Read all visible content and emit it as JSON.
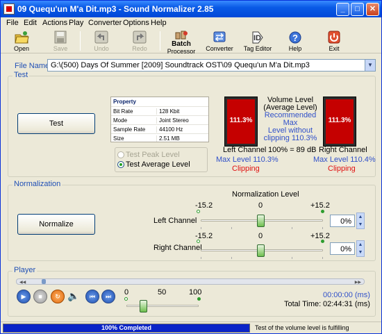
{
  "window": {
    "title": "09 Quequ'un M'a Dit.mp3 - Sound Normalizer 2.85"
  },
  "menu": [
    "File",
    "Edit",
    "Actions",
    "Play",
    "Converter",
    "Options",
    "Help"
  ],
  "toolbar": {
    "open": "Open",
    "save": "Save",
    "undo": "Undo",
    "redo": "Redo",
    "batch1": "Batch",
    "batch2": "Processor",
    "converter": "Converter",
    "tag": "Tag Editor",
    "help": "Help",
    "exit": "Exit"
  },
  "file": {
    "label": "File Name:",
    "value": "G:\\(500) Days Of Summer [2009] Soundtrack OST\\09 Quequ'un M'a Dit.mp3"
  },
  "test": {
    "group": "Test",
    "button": "Test",
    "props": {
      "header": "Property",
      "rows": [
        [
          "Bit Rate",
          "128 Kbit"
        ],
        [
          "Mode",
          "Joint Stereo"
        ],
        [
          "Sample Rate",
          "44100 Hz"
        ],
        [
          "Size",
          "2.51 MB"
        ]
      ]
    },
    "radio_peak": "Test Peak Level",
    "radio_avg": "Test Average Level",
    "vl1": "Volume Level",
    "vl2": "(Average Level)",
    "rec1": "Recommended Max",
    "rec2": "Level without",
    "rec3": "clipping 110.3%",
    "ref": "100% = 89 dB",
    "left": {
      "name": "Left Channel",
      "value": "111.3%",
      "max": "Max Level 110.3%",
      "state": "Clipping",
      "fill": 1.0
    },
    "right": {
      "name": "Right Channel",
      "value": "111.3%",
      "max": "Max Level 110.4%",
      "state": "Clipping",
      "fill": 1.0
    }
  },
  "norm": {
    "group": "Normalization",
    "button": "Normalize",
    "title": "Normalization Level",
    "min": "-15.2",
    "mid": "0",
    "max": "+15.2",
    "left": {
      "label": "Left Channel",
      "value": "0%"
    },
    "right": {
      "label": "Right Channel",
      "value": "0%"
    }
  },
  "player": {
    "group": "Player",
    "v0": "0",
    "v50": "50",
    "v100": "100",
    "time": "00:00:00 (ms)",
    "total_label": "Total Time:",
    "total": "02:44:31 (ms)"
  },
  "status": {
    "progress": "100% Completed",
    "text": "Test of the volume level is fulfilling"
  }
}
